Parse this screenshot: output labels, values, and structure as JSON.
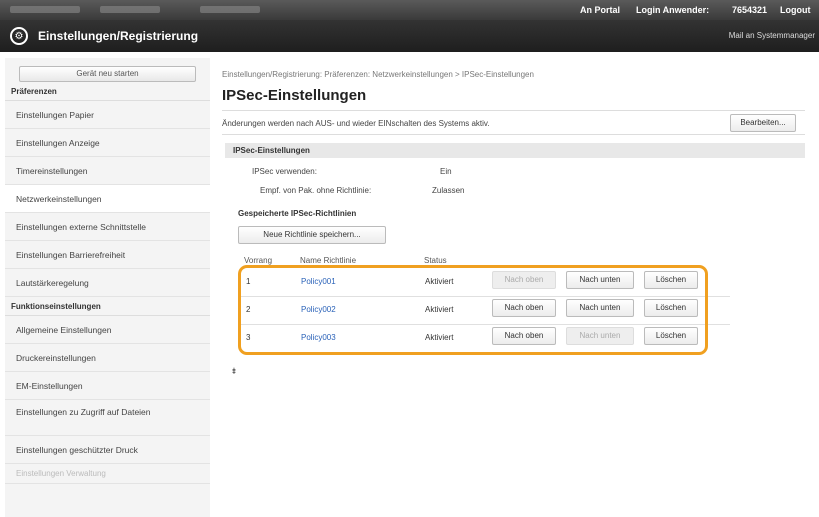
{
  "topbar": {
    "portal_link": "An Portal",
    "login_label": "Login Anwender:",
    "login_user": "7654321",
    "logout": "Logout"
  },
  "header": {
    "title": "Einstellungen/Registrierung",
    "mail": "Mail an Systemmanager"
  },
  "sidebar": {
    "restart_button": "Gerät neu starten",
    "section_preferences": "Präferenzen",
    "preferences_items": [
      "Einstellungen Papier",
      "Einstellungen Anzeige",
      "Timereinstellungen",
      "Netzwerkeinstellungen",
      "Einstellungen externe Schnittstelle",
      "Einstellungen Barrierefreiheit",
      "Lautstärkeregelung"
    ],
    "section_functions": "Funktionseinstellungen",
    "function_items": [
      "Allgemeine Einstellungen",
      "Druckereinstellungen",
      "EM-Einstellungen",
      "Einstellungen zu Zugriff auf Dateien",
      "Einstellungen geschützter Druck",
      "Einstellungen Verwaltung"
    ]
  },
  "main": {
    "breadcrumb": "Einstellungen/Registrierung: Präferenzen: Netzwerkeinstellungen > IPSec-Einstellungen",
    "title": "IPSec-Einstellungen",
    "notice": "Änderungen werden nach AUS- und wieder EINschalten des Systems aktiv.",
    "edit_button": "Bearbeiten...",
    "section_title": "IPSec-Einstellungen",
    "ipsec_use_label": "IPSec verwenden:",
    "ipsec_use_value": "Ein",
    "recv_label": "Empf. von Pak. ohne Richtlinie:",
    "recv_value": "Zulassen",
    "saved_title": "Gespeicherte IPSec-Richtlinien",
    "new_button": "Neue Richtlinie speichern...",
    "columns": [
      "Vorrang",
      "Name Richtlinie",
      "Status"
    ],
    "policies": [
      {
        "priority": "1",
        "name": "Policy001",
        "status": "Aktiviert",
        "up": "Nach oben",
        "down": "Nach unten",
        "delete": "Löschen"
      },
      {
        "priority": "2",
        "name": "Policy002",
        "status": "Aktiviert",
        "up": "Nach oben",
        "down": "Nach unten",
        "delete": "Löschen"
      },
      {
        "priority": "3",
        "name": "Policy003",
        "status": "Aktiviert",
        "up": "Nach oben",
        "down": "Nach unten",
        "delete": "Löschen"
      }
    ],
    "to_top": "⯒"
  },
  "colors": {
    "highlight": "#f0a020",
    "link": "#2a62b8"
  }
}
